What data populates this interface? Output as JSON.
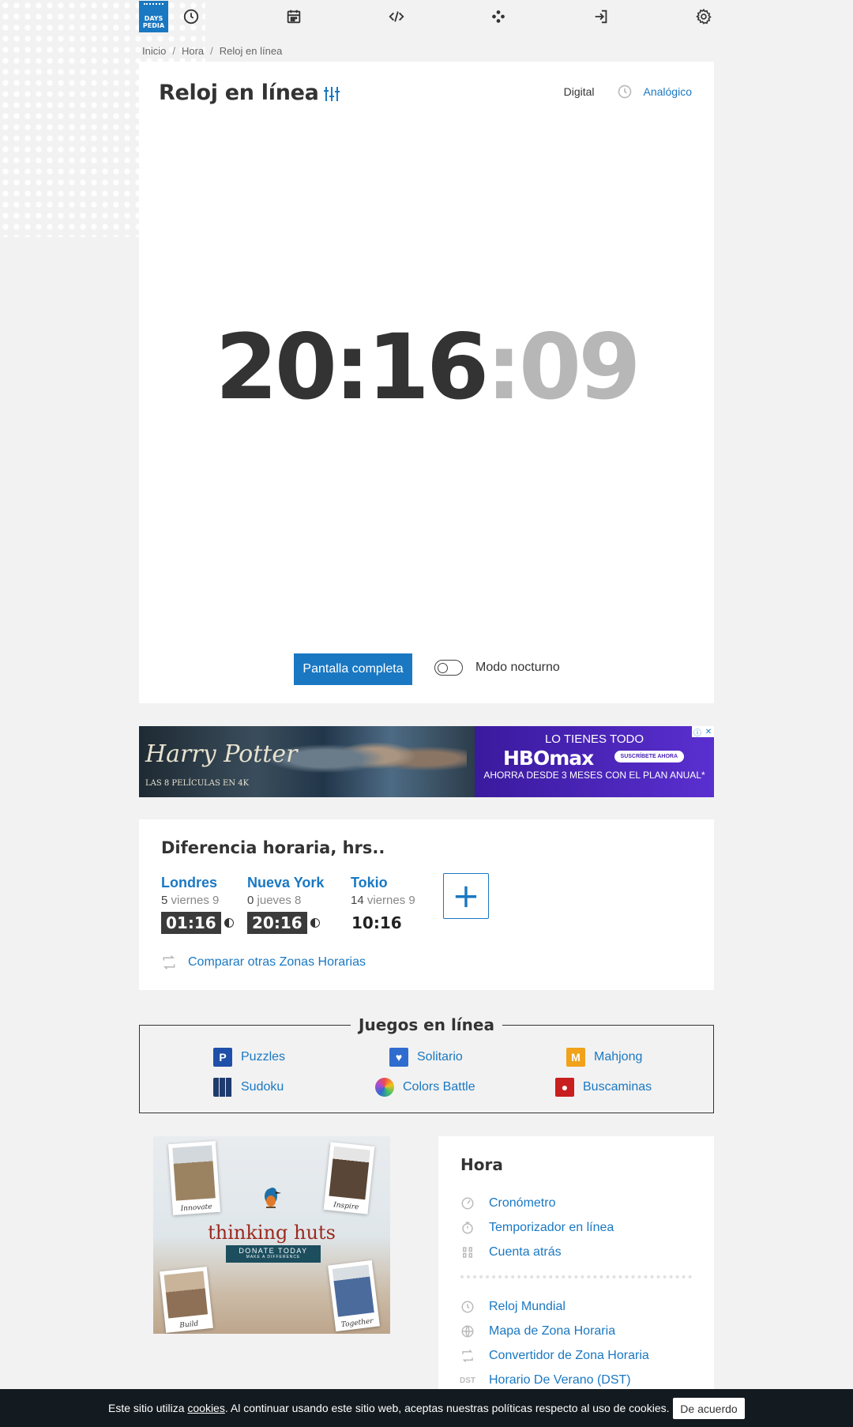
{
  "logo": {
    "line1": "DAYS",
    "line2": "PEDIA"
  },
  "breadcrumb": {
    "items": [
      "Inicio",
      "Hora",
      "Reloj en línea"
    ],
    "separator": "/"
  },
  "clock": {
    "title": "Reloj en línea",
    "mode_digital": "Digital",
    "mode_analog": "Analógico",
    "hours_minutes": "20:16",
    "seconds": ":09",
    "fullscreen_label": "Pantalla completa",
    "night_mode_label": "Modo nocturno"
  },
  "ad": {
    "left_title": "Harry Potter",
    "left_sub": "LAS 8 PELÍCULAS EN 4K",
    "right_line1": "LO TIENES TODO",
    "right_brand": "HBOmax",
    "right_cta": "SUSCRÍBETE AHORA",
    "right_line3": "AHORRA DESDE 3 MESES CON EL PLAN ANUAL*"
  },
  "time_diff": {
    "title": "Diferencia horaria, hrs..",
    "cities": [
      {
        "name": "Londres",
        "offset": "5",
        "day": "viernes 9",
        "time": "01:16"
      },
      {
        "name": "Nueva York",
        "offset": "0",
        "day": "jueves 8",
        "time": "20:16"
      },
      {
        "name": "Tokio",
        "offset": "14",
        "day": "viernes 9",
        "time": "10:16"
      }
    ],
    "add_label": "+",
    "compare_label": "Comparar otras Zonas Horarias"
  },
  "games": {
    "title": "Juegos en línea",
    "items": [
      "Puzzles",
      "Solitario",
      "Mahjong",
      "Sudoku",
      "Colors Battle",
      "Buscaminas"
    ]
  },
  "promo": {
    "brand": "thinking huts",
    "donate": "DONATE TODAY",
    "donate_sub": "MAKE A DIFFERENCE",
    "captions": [
      "Innovate",
      "Inspire",
      "Build",
      "Together"
    ]
  },
  "hora": {
    "title": "Hora",
    "links": [
      "Cronómetro",
      "Temporizador en línea",
      "Cuenta atrás",
      "Reloj Mundial",
      "Mapa de Zona Horaria",
      "Convertidor de Zona Horaria",
      "Horario De Verano (DST)"
    ],
    "dst_badge": "DST"
  },
  "cookie": {
    "prefix": "Este sitio utiliza ",
    "link": "cookies",
    "suffix": ". Al continuar usando este sitio web, aceptas nuestras políticas respecto al uso de cookies.",
    "accept": "De acuerdo"
  },
  "colors": {
    "accent": "#1a78c2",
    "dark": "#333333",
    "seconds": "#b7b7b7",
    "cookie_bg": "#141b20"
  }
}
